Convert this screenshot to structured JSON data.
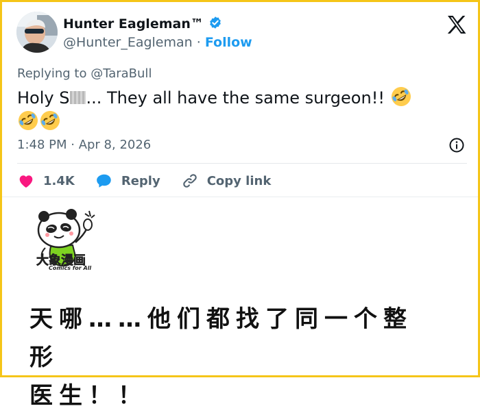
{
  "tweet": {
    "display_name": "Hunter Eagleman™",
    "handle": "@Hunter_Eagleman",
    "separator": " · ",
    "follow_label": "Follow",
    "replying_prefix": "Replying to ",
    "replying_to": "@TaraBull",
    "text_before": "Holy S",
    "text_after": "...  They all have the same surgeon!! ",
    "timestamp": "1:48 PM · Apr 8, 2026",
    "likes_count": "1.4K",
    "reply_label": "Reply",
    "copy_link_label": "Copy link",
    "icons": [
      "verified-badge-icon",
      "x-logo-icon",
      "info-icon",
      "heart-icon",
      "reply-bubble-icon",
      "link-icon",
      "rolling-laughing-emoji"
    ],
    "colors": {
      "accent": "#1d9bf0",
      "like": "#f91880",
      "frame": "#f5c518",
      "muted": "#536471"
    }
  },
  "comic": {
    "brand_logo": "大象漫画",
    "brand_tagline": "Comics for All",
    "caption_line1": "天哪……他们都找了同一个整形",
    "caption_line2": "医生！！"
  }
}
